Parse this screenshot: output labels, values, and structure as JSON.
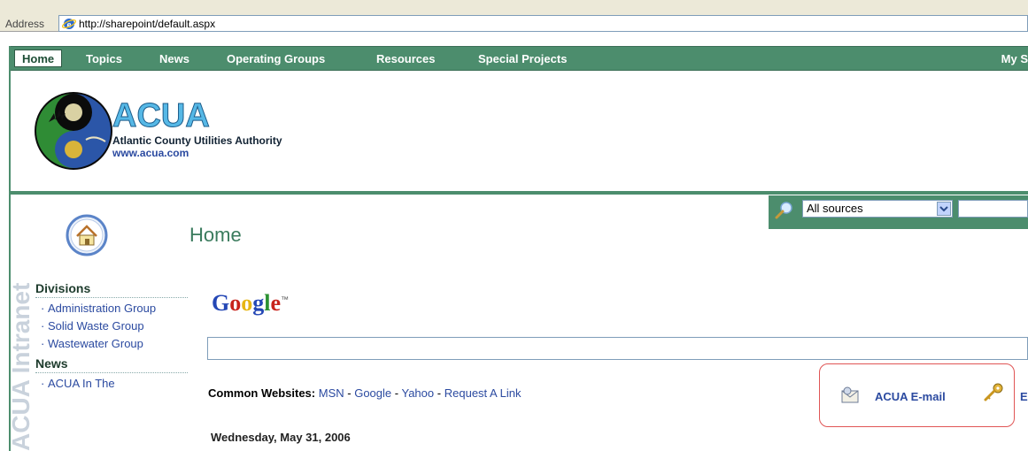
{
  "browser": {
    "address_label": "Address",
    "url": "http://sharepoint/default.aspx"
  },
  "topnav": {
    "home": "Home",
    "items": [
      "Topics",
      "News",
      "Operating Groups",
      "Resources",
      "Special Projects"
    ],
    "right": "My S"
  },
  "logo": {
    "acronym": "ACUA",
    "name": "Atlantic County Utilities Authority",
    "website": "www.acua.com"
  },
  "search": {
    "scope": "All sources"
  },
  "page": {
    "title": "Home"
  },
  "watermark": "ACUA Intranet",
  "leftnav": {
    "divisions_title": "Divisions",
    "divisions": [
      "Administration Group",
      "Solid Waste Group",
      "Wastewater Group"
    ],
    "news_title": "News",
    "news": [
      "ACUA In The"
    ]
  },
  "google": {
    "logo_letters": [
      "G",
      "o",
      "o",
      "g",
      "l",
      "e"
    ],
    "tm": "™"
  },
  "common_sites": {
    "label": "Common Websites:",
    "links": [
      "MSN",
      "Google",
      "Yahoo",
      "Request A Link"
    ]
  },
  "email": {
    "link": "ACUA E-mail",
    "cut": "E"
  },
  "date": "Wednesday, May 31, 2006",
  "colors": {
    "nav_green": "#4c8d6d",
    "link_blue": "#2b4aa0",
    "highlight_red": "#e05555"
  }
}
